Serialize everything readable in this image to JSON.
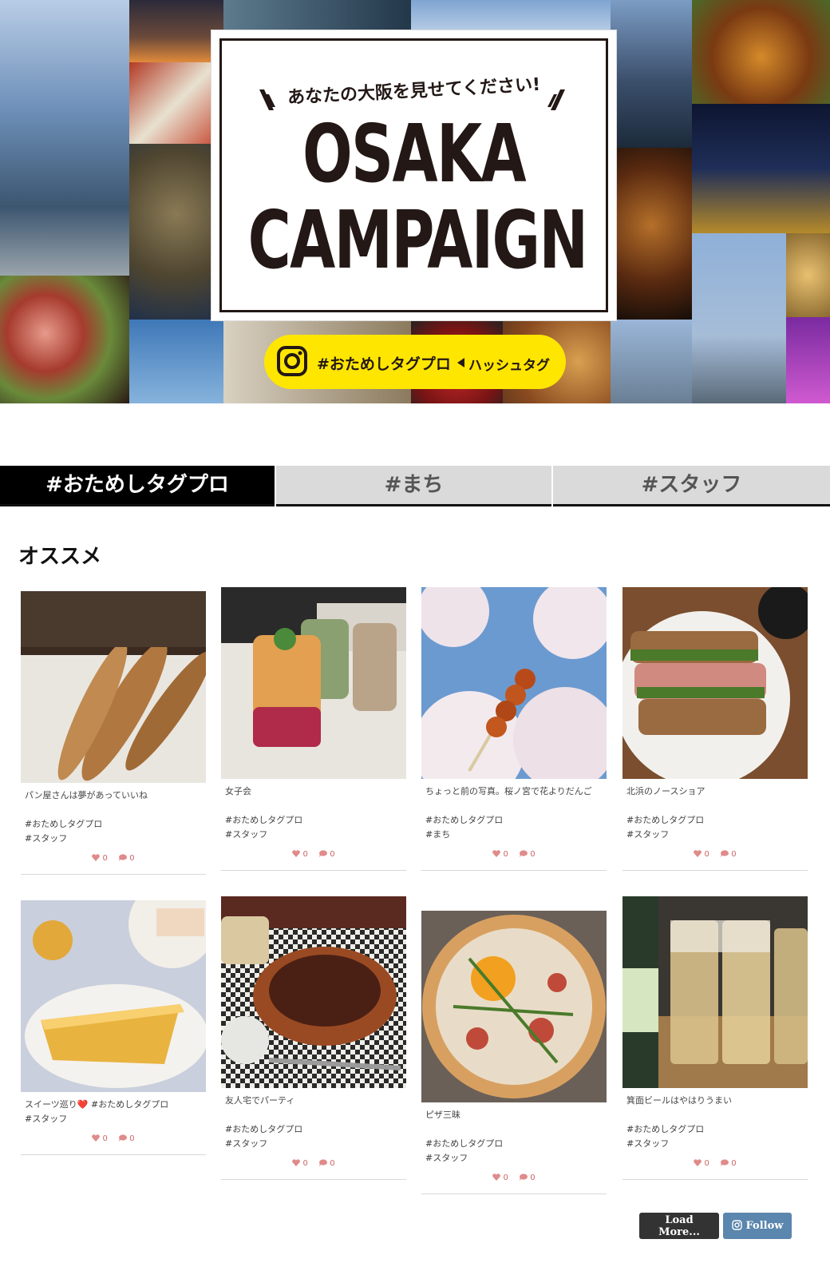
{
  "hero": {
    "tagline": "あなたの大阪を見せてください!",
    "title_line1": "OSAKA",
    "title_line2": "CAMPAIGN",
    "badge_hashtag": "#おためしタグプロ",
    "badge_label": "ハッシュタグ",
    "badge_icon": "instagram-icon"
  },
  "tabs": [
    {
      "label": "#おためしタグプロ",
      "active": true
    },
    {
      "label": "#まち",
      "active": false
    },
    {
      "label": "#スタッフ",
      "active": false
    }
  ],
  "section_title": "オススメ",
  "posts": [
    {
      "caption": "パン屋さんは夢があっていいね\n\n#おためしタグプロ\n#スタッフ",
      "likes": "0",
      "comments": "0"
    },
    {
      "caption": "女子会\n\n#おためしタグプロ\n#スタッフ",
      "likes": "0",
      "comments": "0"
    },
    {
      "caption": "ちょっと前の写真。桜ノ宮で花よりだんご\n\n#おためしタグプロ\n#まち",
      "likes": "0",
      "comments": "0"
    },
    {
      "caption": "北浜のノースショア\n\n#おためしタグプロ\n#スタッフ",
      "likes": "0",
      "comments": "0"
    },
    {
      "caption": "スイーツ巡り❤️ #おためしタグプロ\n#スタッフ",
      "likes": "0",
      "comments": "0"
    },
    {
      "caption": "友人宅でパーティ\n\n#おためしタグプロ\n#スタッフ",
      "likes": "0",
      "comments": "0"
    },
    {
      "caption": "ピザ三昧\n\n#おためしタグプロ\n#スタッフ",
      "likes": "0",
      "comments": "0"
    },
    {
      "caption": "箕面ビールはやはりうまい\n\n#おためしタグプロ\n#スタッフ",
      "likes": "0",
      "comments": "0"
    }
  ],
  "buttons": {
    "load_more": "Load More...",
    "follow": "Follow"
  },
  "colors": {
    "badge_yellow": "#ffe600",
    "tab_active": "#000000",
    "tab_inactive": "#dadada",
    "follow_blue": "#5b86ad",
    "stat_pink": "#cc6666"
  }
}
